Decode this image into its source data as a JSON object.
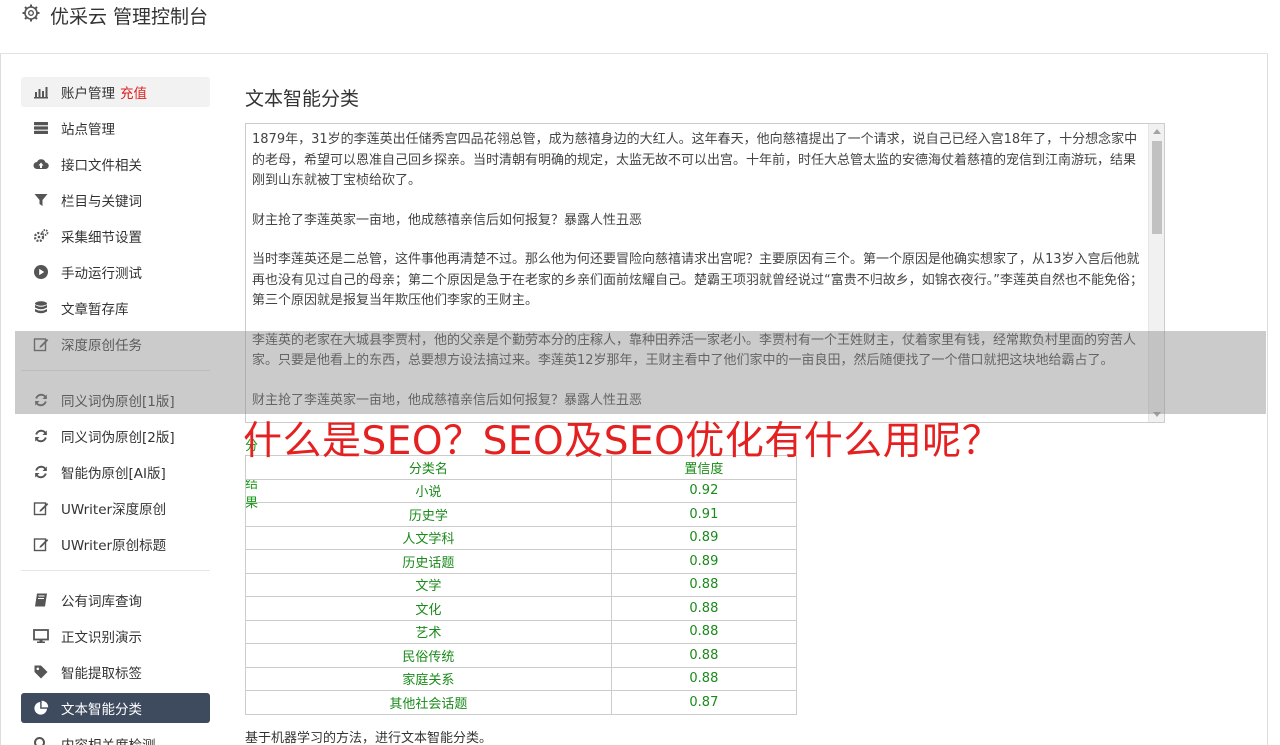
{
  "header": {
    "title": "优采云 管理控制台",
    "icon": "gear-icon"
  },
  "sidebar": {
    "items": [
      {
        "label": "账户管理",
        "extra": "充值",
        "icon": "bar-chart-icon"
      },
      {
        "label": "站点管理",
        "icon": "server-icon"
      },
      {
        "label": "接口文件相关",
        "icon": "cloud-upload-icon"
      },
      {
        "label": "栏目与关键词",
        "icon": "filter-icon"
      },
      {
        "label": "采集细节设置",
        "icon": "gears-icon"
      },
      {
        "label": "手动运行测试",
        "icon": "play-circle-icon"
      },
      {
        "label": "文章暂存库",
        "icon": "database-icon"
      },
      {
        "label": "深度原创任务",
        "icon": "edit-icon"
      },
      {
        "label": "同义词伪原创[1版]",
        "icon": "refresh-icon"
      },
      {
        "label": "同义词伪原创[2版]",
        "icon": "refresh-icon"
      },
      {
        "label": "智能伪原创[AI版]",
        "icon": "refresh-icon"
      },
      {
        "label": "UWriter深度原创",
        "icon": "edit-icon"
      },
      {
        "label": "UWriter原创标题",
        "icon": "edit-icon"
      },
      {
        "label": "公有词库查询",
        "icon": "book-icon"
      },
      {
        "label": "正文识别演示",
        "icon": "monitor-icon"
      },
      {
        "label": "智能提取标签",
        "icon": "tag-icon"
      },
      {
        "label": "文本智能分类",
        "icon": "pie-chart-icon"
      },
      {
        "label": "内容相关度检测",
        "icon": "search-icon"
      }
    ]
  },
  "main": {
    "title": "文本智能分类",
    "text_paragraphs": [
      "1879年，31岁的李莲英出任储秀宫四品花翎总管，成为慈禧身边的大红人。这年春天，他向慈禧提出了一个请求，说自己已经入宫18年了，十分想念家中的老母，希望可以恩准自己回乡探亲。当时清朝有明确的规定，太监无故不可以出宫。十年前，时任大总管太监的安德海仗着慈禧的宠信到江南游玩，结果刚到山东就被丁宝桢给砍了。",
      "财主抢了李莲英家一亩地，他成慈禧亲信后如何报复？暴露人性丑恶",
      "当时李莲英还是二总管，这件事他再清楚不过。那么他为何还要冒险向慈禧请求出宫呢？主要原因有三个。第一个原因是他确实想家了，从13岁入宫后他就再也没有见过自己的母亲；第二个原因是急于在老家的乡亲们面前炫耀自己。楚霸王项羽就曾经说过“富贵不归故乡，如锦衣夜行。”李莲英自然也不能免俗；第三个原因就是报复当年欺压他们李家的王财主。",
      "李莲英的老家在大城县李贾村，他的父亲是个勤劳本分的庄稼人，靠种田养活一家老小。李贾村有一个王姓财主，仗着家里有钱，经常欺负村里面的穷苦人家。只要是他看上的东西，总要想方设法搞过来。李莲英12岁那年，王财主看中了他们家中的一亩良田，然后随便找了一个借口就把这块地给霸占了。",
      "财主抢了李莲英家一亩地，他成慈禧亲信后如何报复？暴露人性丑恶"
    ],
    "result_label": "分类结果",
    "table": {
      "headers": [
        "分类名",
        "置信度"
      ],
      "rows": [
        [
          "小说",
          "0.92"
        ],
        [
          "历史学",
          "0.91"
        ],
        [
          "人文学科",
          "0.89"
        ],
        [
          "历史话题",
          "0.89"
        ],
        [
          "文学",
          "0.88"
        ],
        [
          "文化",
          "0.88"
        ],
        [
          "艺术",
          "0.88"
        ],
        [
          "民俗传统",
          "0.88"
        ],
        [
          "家庭关系",
          "0.88"
        ],
        [
          "其他社会话题",
          "0.87"
        ]
      ]
    },
    "footnote": "基于机器学习的方法，进行文本智能分类。"
  },
  "overlay": {
    "headline": "什么是SEO？SEO及SEO优化有什么用呢？"
  },
  "colors": {
    "active_nav_bg": "#3e4a5e",
    "accent_red": "#e52020",
    "result_green": "#1a8a1a"
  }
}
